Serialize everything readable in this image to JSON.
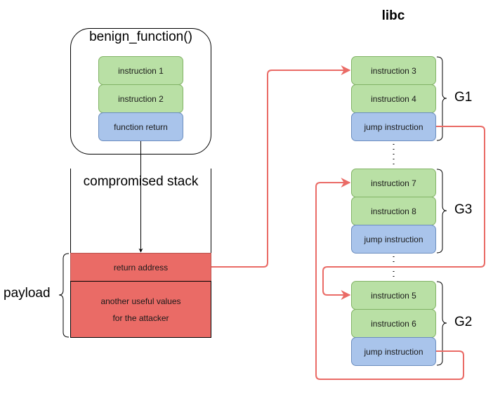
{
  "benign_function": {
    "title": "benign_function()",
    "blocks": [
      {
        "label": "instruction 1",
        "kind": "instruction"
      },
      {
        "label": "instruction 2",
        "kind": "instruction"
      },
      {
        "label": "function return",
        "kind": "control"
      }
    ]
  },
  "stack": {
    "title": "compromised stack",
    "payload_label": "payload",
    "cells": [
      {
        "lines": [
          "return address"
        ]
      },
      {
        "lines": [
          "another useful values",
          "for the attacker"
        ]
      }
    ]
  },
  "libc": {
    "title": "libc",
    "gadgets": [
      {
        "name": "G1",
        "blocks": [
          "instruction 3",
          "instruction 4",
          "jump instruction"
        ]
      },
      {
        "name": "G3",
        "blocks": [
          "instruction 7",
          "instruction 8",
          "jump instruction"
        ]
      },
      {
        "name": "G2",
        "blocks": [
          "instruction 5",
          "instruction 6",
          "jump instruction"
        ]
      }
    ]
  },
  "colors": {
    "instruction_fill": "#b9e0a5",
    "instruction_stroke": "#82b366",
    "control_fill": "#a9c4eb",
    "control_stroke": "#6c8ebf",
    "payload_fill": "#ea6b66",
    "flow_arrow": "#ea6b66"
  },
  "flow": [
    {
      "from": "return address",
      "to": "G1.instruction 3"
    },
    {
      "from": "G1.jump instruction",
      "to": "G2.instruction 5"
    },
    {
      "from": "G2.jump instruction",
      "to": "G3.instruction 7"
    }
  ]
}
